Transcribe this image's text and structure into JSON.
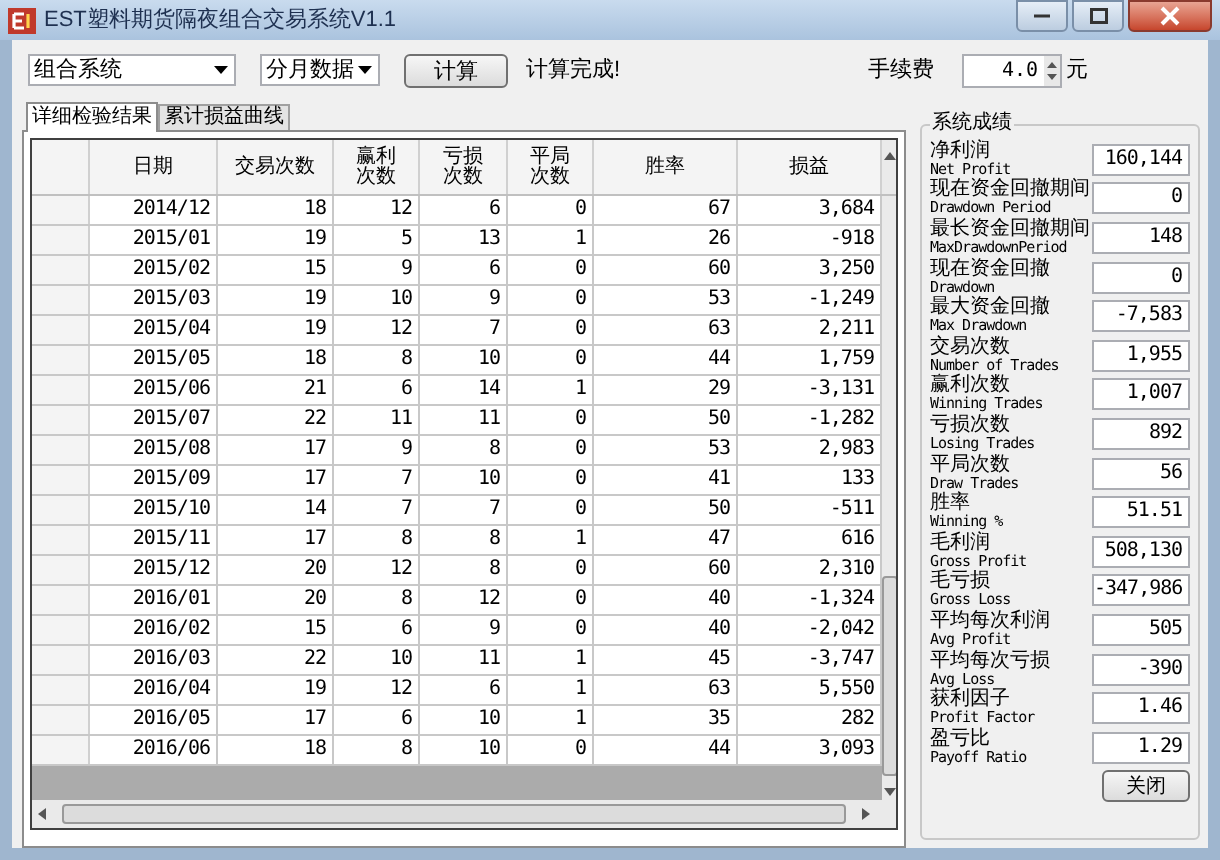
{
  "window": {
    "title": "EST塑料期货隔夜组合交易系统V1.1"
  },
  "toolbar": {
    "system_select": "组合系统",
    "period_select": "分月数据",
    "calc_button": "计算",
    "status": "计算完成!",
    "fee_label": "手续费",
    "fee_value": "4.0",
    "fee_unit": "元"
  },
  "tabs": [
    {
      "label": "详细检验结果",
      "selected": true
    },
    {
      "label": "累计损益曲线",
      "selected": false
    }
  ],
  "table": {
    "columns": [
      "日期",
      "交易次数",
      "赢利次数",
      "亏损次数",
      "平局次数",
      "胜率",
      "损益"
    ],
    "rows": [
      [
        "2014/12",
        "18",
        "12",
        "6",
        "0",
        "67",
        "3,684"
      ],
      [
        "2015/01",
        "19",
        "5",
        "13",
        "1",
        "26",
        "-918"
      ],
      [
        "2015/02",
        "15",
        "9",
        "6",
        "0",
        "60",
        "3,250"
      ],
      [
        "2015/03",
        "19",
        "10",
        "9",
        "0",
        "53",
        "-1,249"
      ],
      [
        "2015/04",
        "19",
        "12",
        "7",
        "0",
        "63",
        "2,211"
      ],
      [
        "2015/05",
        "18",
        "8",
        "10",
        "0",
        "44",
        "1,759"
      ],
      [
        "2015/06",
        "21",
        "6",
        "14",
        "1",
        "29",
        "-3,131"
      ],
      [
        "2015/07",
        "22",
        "11",
        "11",
        "0",
        "50",
        "-1,282"
      ],
      [
        "2015/08",
        "17",
        "9",
        "8",
        "0",
        "53",
        "2,983"
      ],
      [
        "2015/09",
        "17",
        "7",
        "10",
        "0",
        "41",
        "133"
      ],
      [
        "2015/10",
        "14",
        "7",
        "7",
        "0",
        "50",
        "-511"
      ],
      [
        "2015/11",
        "17",
        "8",
        "8",
        "1",
        "47",
        "616"
      ],
      [
        "2015/12",
        "20",
        "12",
        "8",
        "0",
        "60",
        "2,310"
      ],
      [
        "2016/01",
        "20",
        "8",
        "12",
        "0",
        "40",
        "-1,324"
      ],
      [
        "2016/02",
        "15",
        "6",
        "9",
        "0",
        "40",
        "-2,042"
      ],
      [
        "2016/03",
        "22",
        "10",
        "11",
        "1",
        "45",
        "-3,747"
      ],
      [
        "2016/04",
        "19",
        "12",
        "6",
        "1",
        "63",
        "5,550"
      ],
      [
        "2016/05",
        "17",
        "6",
        "10",
        "1",
        "35",
        "282"
      ],
      [
        "2016/06",
        "18",
        "8",
        "10",
        "0",
        "44",
        "3,093"
      ]
    ]
  },
  "summary": {
    "title": "系统成绩",
    "items": [
      {
        "label": "净利润",
        "label_en": "Net Profit",
        "value": "160,144"
      },
      {
        "label": "现在资金回撤期间",
        "label_en": "Drawdown Period",
        "value": "0"
      },
      {
        "label": "最长资金回撤期间",
        "label_en": "MaxDrawdownPeriod",
        "value": "148"
      },
      {
        "label": "现在资金回撤",
        "label_en": "Drawdown",
        "value": "0"
      },
      {
        "label": "最大资金回撤",
        "label_en": "Max Drawdown",
        "value": "-7,583"
      },
      {
        "label": "交易次数",
        "label_en": "Number of Trades",
        "value": "1,955"
      },
      {
        "label": "赢利次数",
        "label_en": "Winning Trades",
        "value": "1,007"
      },
      {
        "label": "亏损次数",
        "label_en": "Losing Trades",
        "value": "892"
      },
      {
        "label": "平局次数",
        "label_en": "Draw Trades",
        "value": "56"
      },
      {
        "label": "胜率",
        "label_en": "Winning %",
        "value": "51.51"
      },
      {
        "label": "毛利润",
        "label_en": "Gross Profit",
        "value": "508,130"
      },
      {
        "label": "毛亏损",
        "label_en": "Gross Loss",
        "value": "-347,986"
      },
      {
        "label": "平均每次利润",
        "label_en": "Avg Profit",
        "value": "505"
      },
      {
        "label": "平均每次亏损",
        "label_en": "Avg Loss",
        "value": "-390"
      },
      {
        "label": "获利因子",
        "label_en": "Profit Factor",
        "value": "1.46"
      },
      {
        "label": "盈亏比",
        "label_en": "Payoff Ratio",
        "value": "1.29"
      }
    ],
    "close_button": "关闭"
  }
}
